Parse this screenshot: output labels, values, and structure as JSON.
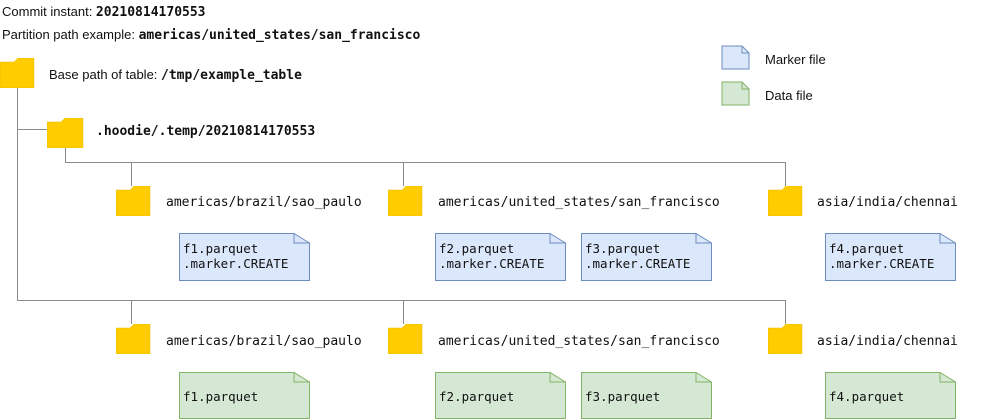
{
  "header": {
    "commit_label": "Commit instant: ",
    "commit_value": "20210814170553",
    "partition_label": "Partition path example: ",
    "partition_value": "americas/united_states/san_francisco"
  },
  "base": {
    "label": "Base path of table: ",
    "value": "/tmp/example_table"
  },
  "temp_folder": ".hoodie/.temp/20210814170553",
  "legend": {
    "marker": "Marker file",
    "data": "Data file"
  },
  "colors": {
    "marker_fill": "#dbe7fb",
    "marker_stroke": "#6c8ebf",
    "data_fill": "#d5e8d4",
    "data_stroke": "#82b366",
    "folder_fill": "#ffcc00",
    "connector": "#8a8a8a"
  },
  "marker_partitions": [
    {
      "label": "americas/brazil/sao_paulo",
      "files": [
        "f1.parquet\n.marker.CREATE"
      ]
    },
    {
      "label": "americas/united_states/san_francisco",
      "files": [
        "f2.parquet\n.marker.CREATE",
        "f3.parquet\n.marker.CREATE"
      ]
    },
    {
      "label": "asia/india/chennai",
      "files": [
        "f4.parquet\n.marker.CREATE"
      ]
    }
  ],
  "data_partitions": [
    {
      "label": "americas/brazil/sao_paulo",
      "files": [
        "f1.parquet"
      ]
    },
    {
      "label": "americas/united_states/san_francisco",
      "files": [
        "f2.parquet",
        "f3.parquet"
      ]
    },
    {
      "label": "asia/india/chennai",
      "files": [
        "f4.parquet"
      ]
    }
  ]
}
